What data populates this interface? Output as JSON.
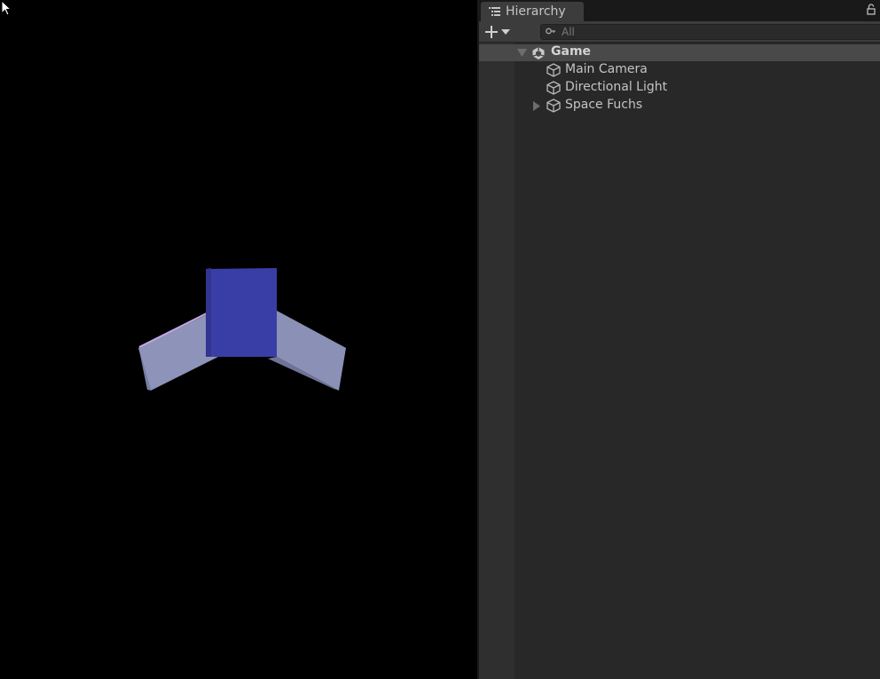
{
  "window": {
    "tab_title": "Hierarchy",
    "tab_icon": "hierarchy-list-icon",
    "lock_icon": "lock-icon"
  },
  "toolbar": {
    "add_icon": "plus-icon",
    "add_dropdown_icon": "caret-down-icon",
    "search_placeholder": "All",
    "search_icon": "search-icon"
  },
  "tree": {
    "scene": {
      "name": "Game",
      "expanded": true,
      "icon": "unity-scene-icon"
    },
    "items": [
      {
        "name": "Main Camera",
        "icon": "gameobject-cube-icon",
        "has_children": false
      },
      {
        "name": "Directional Light",
        "icon": "gameobject-cube-icon",
        "has_children": false
      },
      {
        "name": "Space Fuchs",
        "icon": "gameobject-cube-icon",
        "has_children": true,
        "expanded": false
      }
    ]
  },
  "colors": {
    "game_background": "#000000",
    "panel_background": "#282828",
    "scene_row_highlight": "#494949",
    "ship_body": "#3a3ea6",
    "ship_wing": "#8e93ba",
    "wing_edge_highlight": "#c7a3e0"
  }
}
